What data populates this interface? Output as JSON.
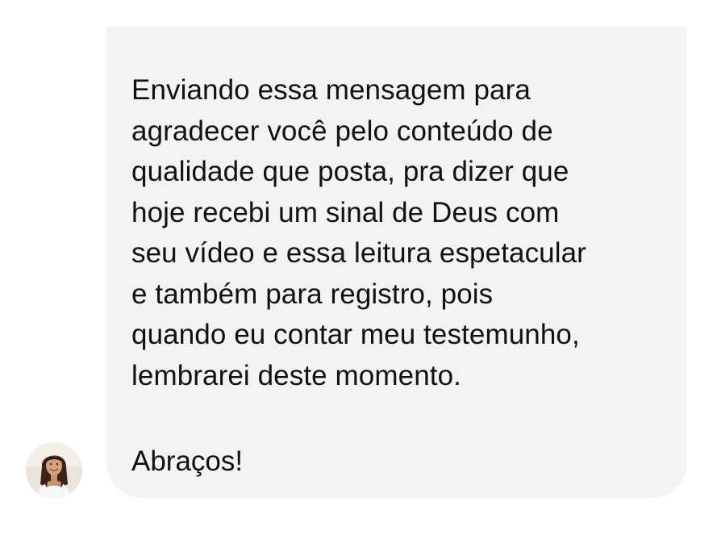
{
  "message": {
    "body": "Enviando essa mensagem para\nagradecer você pelo conteúdo de\nqualidade que posta, pra dizer que\nhoje recebi um sinal de Deus com\nseu vídeo e essa leitura espetacular\ne também para registro, pois\nquando eu contar meu testemunho,\nlembrarei deste momento.",
    "signoff": "Abraços!"
  },
  "sender": {
    "avatar_icon": "user-avatar-photo"
  },
  "colors": {
    "bubble_background": "#f2f3f5",
    "text": "#111111",
    "page_background": "#ffffff"
  }
}
